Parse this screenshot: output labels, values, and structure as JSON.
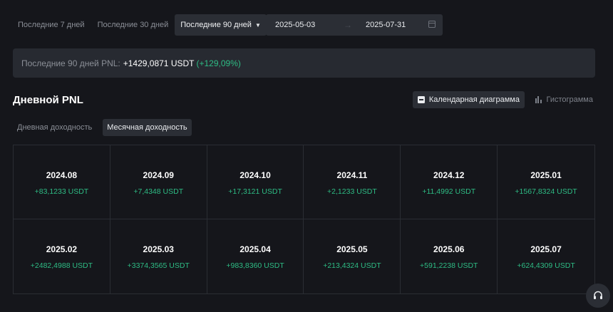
{
  "filters": {
    "range_7": "Последние 7 дней",
    "range_30": "Последние 30 дней",
    "range_selected": "Последние 90 дней",
    "date_start": "2025-05-03",
    "date_end": "2025-07-31"
  },
  "summary": {
    "label": "Последние 90 дней PNL:",
    "value": "+1429,0871 USDT",
    "percent": "(+129,09%)"
  },
  "section": {
    "title": "Дневной PNL",
    "view_calendar": "Календарная диаграмма",
    "view_histogram": "Гистограмма"
  },
  "tabs": {
    "daily": "Дневная доходность",
    "monthly": "Месячная доходность"
  },
  "months": [
    {
      "month": "2024.08",
      "pnl": "+83,1233 USDT"
    },
    {
      "month": "2024.09",
      "pnl": "+7,4348 USDT"
    },
    {
      "month": "2024.10",
      "pnl": "+17,3121 USDT"
    },
    {
      "month": "2024.11",
      "pnl": "+2,1233 USDT"
    },
    {
      "month": "2024.12",
      "pnl": "+11,4992 USDT"
    },
    {
      "month": "2025.01",
      "pnl": "+1567,8324 USDT"
    },
    {
      "month": "2025.02",
      "pnl": "+2482,4988 USDT"
    },
    {
      "month": "2025.03",
      "pnl": "+3374,3565 USDT"
    },
    {
      "month": "2025.04",
      "pnl": "+983,8360 USDT"
    },
    {
      "month": "2025.05",
      "pnl": "+213,4324 USDT"
    },
    {
      "month": "2025.06",
      "pnl": "+591,2238 USDT"
    },
    {
      "month": "2025.07",
      "pnl": "+624,4309 USDT"
    }
  ],
  "colors": {
    "positive": "#2ebd85",
    "background": "#15161b",
    "panel": "#272a31"
  }
}
